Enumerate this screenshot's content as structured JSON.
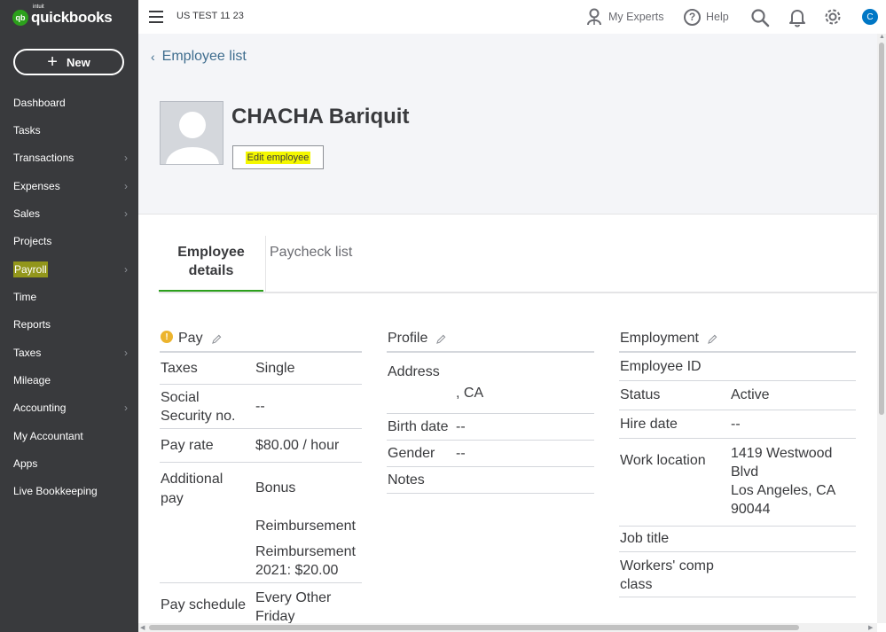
{
  "app": {
    "logo_small": "intuit",
    "logo": "quickbooks",
    "logo_mark": "qb"
  },
  "sidebar": {
    "new_label": "New",
    "items": [
      {
        "label": "Dashboard",
        "chevron": false
      },
      {
        "label": "Tasks",
        "chevron": false
      },
      {
        "label": "Transactions",
        "chevron": true
      },
      {
        "label": "Expenses",
        "chevron": true
      },
      {
        "label": "Sales",
        "chevron": true
      },
      {
        "label": "Projects",
        "chevron": false
      },
      {
        "label": "Payroll",
        "chevron": true,
        "highlighted": true
      },
      {
        "label": "Time",
        "chevron": false
      },
      {
        "label": "Reports",
        "chevron": false
      },
      {
        "label": "Taxes",
        "chevron": true
      },
      {
        "label": "Mileage",
        "chevron": false
      },
      {
        "label": "Accounting",
        "chevron": true
      },
      {
        "label": "My Accountant",
        "chevron": false
      },
      {
        "label": "Apps",
        "chevron": false
      },
      {
        "label": "Live Bookkeeping",
        "chevron": false
      }
    ]
  },
  "topbar": {
    "company": "US TEST 11 23",
    "my_experts": "My Experts",
    "help": "Help",
    "avatar_initial": "C"
  },
  "employee": {
    "back_label": "Employee list",
    "name": "CHACHA Bariquit",
    "edit_label": "Edit employee"
  },
  "tabs": {
    "details_line1": "Employee",
    "details_line2": "details",
    "paycheck": "Paycheck list"
  },
  "pay": {
    "title": "Pay",
    "taxes_label": "Taxes",
    "taxes_value": "Single",
    "ssn_label_1": "Social",
    "ssn_label_2": "Security no.",
    "ssn_value": "--",
    "rate_label": "Pay rate",
    "rate_value": "$80.00 / hour",
    "additional_label_1": "Additional",
    "additional_label_2": "pay",
    "additional_1": "Bonus",
    "additional_2": "Reimbursement",
    "additional_3a": "Reimbursement",
    "additional_3b": "2021: $20.00",
    "schedule_label": "Pay schedule",
    "schedule_value_1": "Every Other",
    "schedule_value_2": "Friday"
  },
  "profile": {
    "title": "Profile",
    "address_label": "Address",
    "address_value": ", CA",
    "birth_label": "Birth date",
    "birth_value": "--",
    "gender_label": "Gender",
    "gender_value": "--",
    "notes_label": "Notes"
  },
  "employment": {
    "title": "Employment",
    "id_label": "Employee ID",
    "status_label": "Status",
    "status_value": "Active",
    "hire_label": "Hire date",
    "hire_value": "--",
    "location_label": "Work location",
    "location_1": "1419 Westwood",
    "location_2": "Blvd",
    "location_3": "Los Angeles, CA",
    "location_4": "90044",
    "job_label": "Job title",
    "comp_label_1": "Workers' comp",
    "comp_label_2": "class"
  },
  "colors": {
    "sidebar": "#393a3d",
    "accent": "#2ca01c",
    "link": "#3f6d8e",
    "highlight": "#f4f700",
    "avatar": "#0077c5",
    "warn": "#ecb42e"
  }
}
